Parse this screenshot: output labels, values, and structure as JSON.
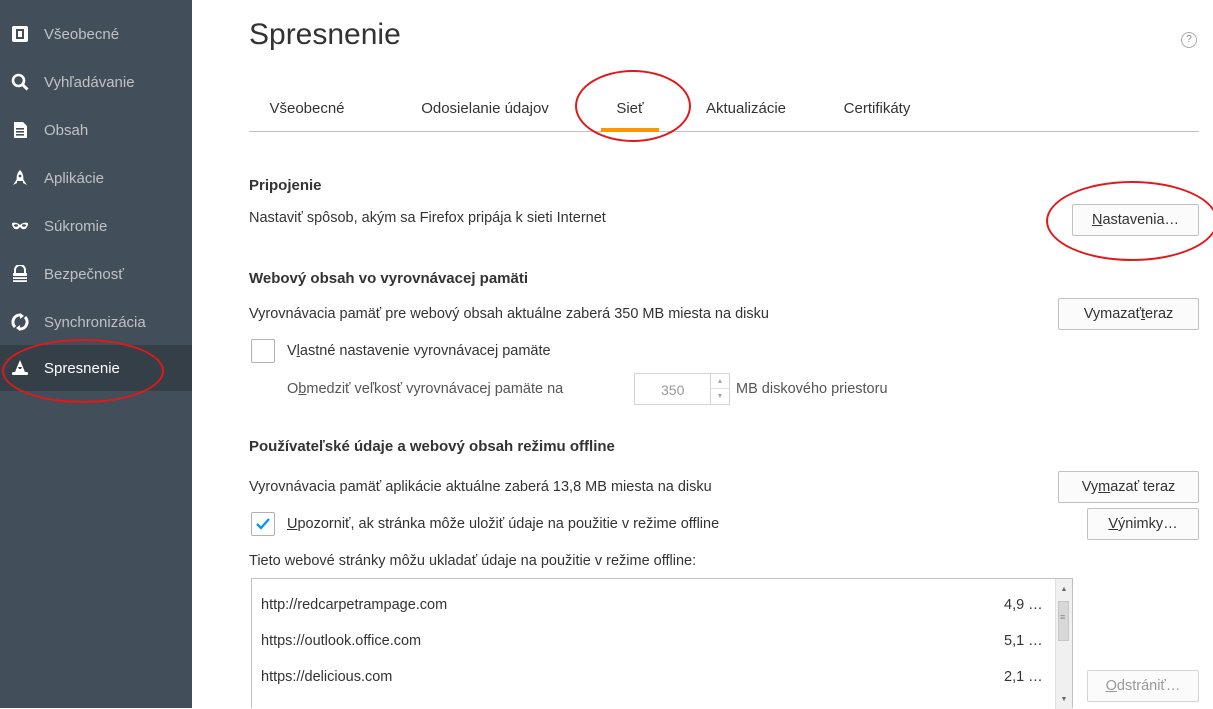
{
  "sidebar": {
    "items": [
      {
        "label": "Všeobecné",
        "icon": "general-icon"
      },
      {
        "label": "Vyhľadávanie",
        "icon": "search-icon"
      },
      {
        "label": "Obsah",
        "icon": "document-icon"
      },
      {
        "label": "Aplikácie",
        "icon": "rocket-icon"
      },
      {
        "label": "Súkromie",
        "icon": "mask-icon"
      },
      {
        "label": "Bezpečnosť",
        "icon": "lock-icon"
      },
      {
        "label": "Synchronizácia",
        "icon": "sync-icon"
      },
      {
        "label": "Spresnenie",
        "icon": "wizard-hat-icon",
        "selected": true
      }
    ]
  },
  "page": {
    "title": "Spresnenie",
    "help_glyph": "?"
  },
  "tabs": [
    {
      "label": "Všeobecné"
    },
    {
      "label": "Odosielanie údajov"
    },
    {
      "label": "Sieť",
      "active": true
    },
    {
      "label": "Aktualizácie"
    },
    {
      "label": "Certifikáty"
    }
  ],
  "connection": {
    "heading": "Pripojenie",
    "description": "Nastaviť spôsob, akým sa Firefox pripája k sieti Internet",
    "settings_button": {
      "prefix": "",
      "accel": "N",
      "suffix": "astavenia…"
    }
  },
  "web_cache": {
    "heading": "Webový obsah vo vyrovnávacej pamäti",
    "description": "Vyrovnávacia pamäť pre webový obsah aktuálne zaberá 350 MB miesta na disku",
    "clear_button": {
      "prefix": "Vymazať ",
      "accel": "t",
      "suffix": "eraz"
    },
    "override_checkbox": {
      "prefix": "V",
      "accel": "l",
      "suffix": "astné nastavenie vyrovnávacej pamäte",
      "checked": false
    },
    "limit_label": {
      "prefix": "O",
      "accel": "b",
      "suffix": "medziť veľkosť vyrovnávacej pamäte na"
    },
    "limit_value": "350",
    "limit_unit": "MB diskového priestoru"
  },
  "offline": {
    "heading": "Používateľské údaje a webový obsah režimu offline",
    "description": "Vyrovnávacia pamäť aplikácie aktuálne zaberá 13,8 MB miesta na disku",
    "clear_button": {
      "prefix": "Vy",
      "accel": "m",
      "suffix": "azať teraz"
    },
    "warn_checkbox": {
      "prefix": "",
      "accel": "U",
      "suffix": "pozorniť, ak stránka môže uložiť údaje na použitie v režime offline",
      "checked": true
    },
    "exceptions_button": {
      "prefix": "",
      "accel": "V",
      "suffix": "ýnimky…"
    },
    "list_label": "Tieto webové stránky môžu ukladať údaje na použitie v režime offline:",
    "sites": [
      {
        "url": "http://redcarpetrampage.com",
        "size": "4,9 …"
      },
      {
        "url": "https://outlook.office.com",
        "size": "5,1 …"
      },
      {
        "url": "https://delicious.com",
        "size": "2,1 …"
      }
    ],
    "remove_button": {
      "prefix": "",
      "accel": "O",
      "suffix": "dstrániť…"
    }
  },
  "colors": {
    "sidebar_bg": "#424f5a",
    "sidebar_selected": "#343f48",
    "tab_accent": "#ff9500",
    "annotation_red": "#e0191b",
    "check_blue": "#0996f8"
  }
}
